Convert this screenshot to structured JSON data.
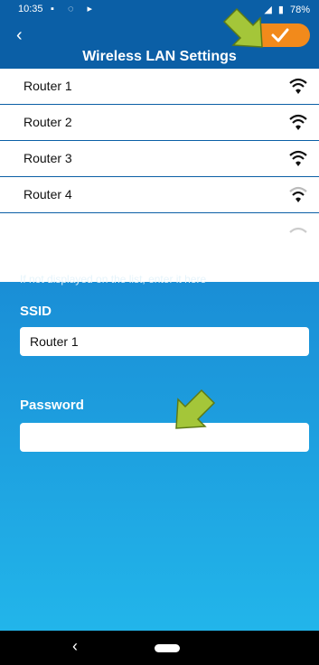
{
  "status": {
    "time": "10:35",
    "battery": "78%"
  },
  "header": {
    "title": "Wireless LAN Settings",
    "back_icon": "chevron-left-icon",
    "confirm_icon": "checkmark-icon",
    "confirm_color": "#f28a1b"
  },
  "networks": [
    {
      "label": "Router 1",
      "signal": "full"
    },
    {
      "label": "Router 2",
      "signal": "full"
    },
    {
      "label": "Router 3",
      "signal": "full"
    },
    {
      "label": "Router 4",
      "signal": "weak"
    }
  ],
  "form": {
    "hint": "If not displayed on the list, enter it here",
    "ssid_label": "SSID",
    "ssid_value": "Router 1",
    "password_label": "Password",
    "password_value": ""
  },
  "colors": {
    "header_bg": "#0b5fa6",
    "panel_top": "#1a8ed6",
    "panel_bottom": "#22b5ea",
    "annotation_arrow": "#a4c639"
  }
}
